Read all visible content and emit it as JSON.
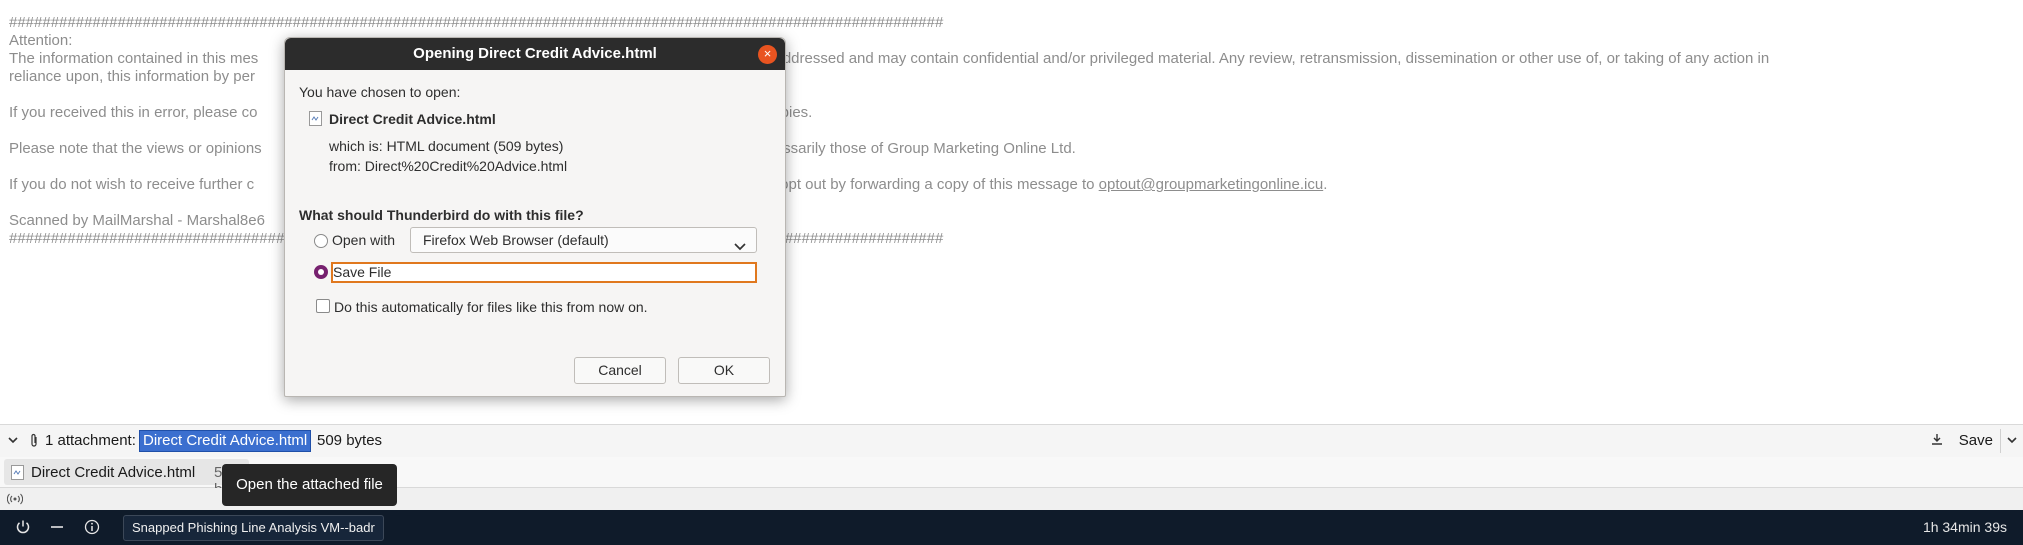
{
  "email": {
    "hash_line": "################################################################################################################",
    "attention": "Attention:",
    "line1": "The information contained in this mes",
    "line1b": "which it is addressed and may contain confidential and/or privileged material. Any review, retransmission, dissemination or other use of, or taking of any action in",
    "line2": "reliance upon, this information by per",
    "line3a": "If you received this in error, please co",
    "line3b": "roy any copies.",
    "line4a": "Please note that the views or opinions",
    "line4b": "necessarily those of Group Marketing Online Ltd.",
    "line5a": "If you do not wish to receive further c",
    "line5b": "lease opt out by forwarding a copy of this message to ",
    "optout_link": "optout@groupmarketingonline.icu",
    "line5c": ".",
    "scanned": "Scanned by MailMarshal - Marshal8e6",
    "hash_line2": "################################################################################################################"
  },
  "dialog": {
    "title": "Opening Direct Credit Advice.html",
    "close": "×",
    "chosen": "You have chosen to open:",
    "filename": "Direct Credit Advice.html",
    "which_is": "which is: HTML document (509 bytes)",
    "from": "from: Direct%20Credit%20Advice.html",
    "question": "What should Thunderbird do with this file?",
    "open_with_label": "Open with",
    "open_with_value": "Firefox Web Browser (default)",
    "save_file_label": "Save File",
    "auto_label": "Do this automatically for files like this from now on.",
    "cancel": "Cancel",
    "ok": "OK"
  },
  "attachments": {
    "count_label": "1 attachment:",
    "name": "Direct Credit Advice.html",
    "size": "509 bytes",
    "save": "Save",
    "item_name": "Direct Credit Advice.html",
    "item_size": "509 bytes",
    "tooltip": "Open the attached file"
  },
  "taskbar": {
    "vm_label": "Snapped Phishing Line Analysis VM--badr",
    "timer": "1h 34min 39s"
  }
}
